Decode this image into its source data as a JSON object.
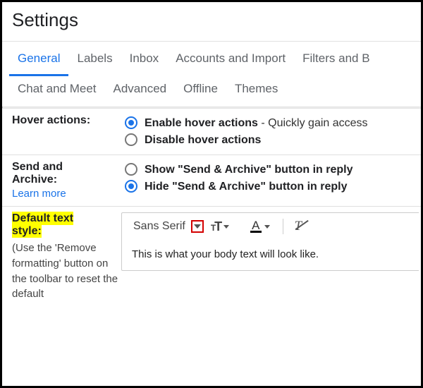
{
  "page_title": "Settings",
  "tabs": {
    "general": "General",
    "labels": "Labels",
    "inbox": "Inbox",
    "accounts": "Accounts and Import",
    "filters": "Filters and B",
    "chat": "Chat and Meet",
    "advanced": "Advanced",
    "offline": "Offline",
    "themes": "Themes"
  },
  "hover": {
    "label": "Hover actions:",
    "enable_strong": "Enable hover actions",
    "enable_desc": " - Quickly gain access",
    "disable": "Disable hover actions"
  },
  "send_archive": {
    "label_line1": "Send and",
    "label_line2": "Archive:",
    "learn_more": "Learn more",
    "show": "Show \"Send & Archive\" button in reply",
    "hide": "Hide \"Send & Archive\" button in reply"
  },
  "default_style": {
    "label_line1": "Default text",
    "label_line2": "style:",
    "help": "(Use the 'Remove formatting' button on the toolbar to reset the default",
    "font_name": "Sans Serif",
    "preview": "This is what your body text will look like."
  }
}
